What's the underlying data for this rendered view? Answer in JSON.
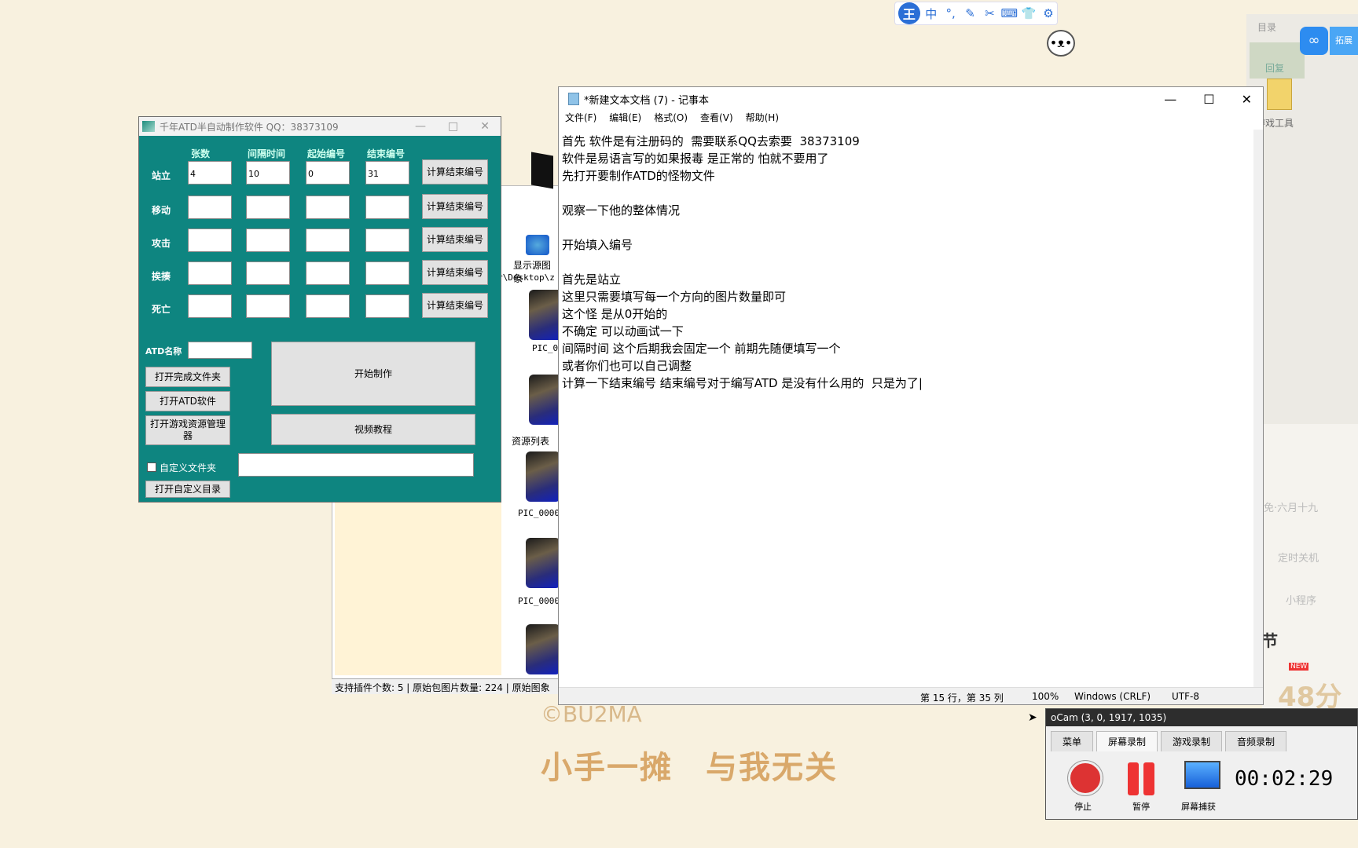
{
  "ime": {
    "logo": "王",
    "items": [
      "中",
      "°,",
      "✎",
      "✂",
      "⌨",
      "👕",
      "⚙"
    ]
  },
  "desktop_right": {
    "mulu": "目录",
    "green_label": "回复",
    "folder_label": "游戏工具",
    "baidu_label": "拓展",
    "items": [
      "免·六月十九",
      "定时关机",
      "小程序",
      "节",
      "48分"
    ],
    "new_badge": "NEW"
  },
  "atd": {
    "title": "千年ATD半自动制作软件 QQ：38373109",
    "headers": [
      "张数",
      "间隔时间",
      "起始编号",
      "结束编号"
    ],
    "rows": [
      {
        "label": "站立",
        "v": [
          "4",
          "10",
          "0",
          "31"
        ]
      },
      {
        "label": "移动",
        "v": [
          "",
          "",
          "",
          ""
        ]
      },
      {
        "label": "攻击",
        "v": [
          "",
          "",
          "",
          ""
        ]
      },
      {
        "label": "挨揍",
        "v": [
          "",
          "",
          "",
          ""
        ]
      },
      {
        "label": "死亡",
        "v": [
          "",
          "",
          "",
          ""
        ]
      }
    ],
    "calc_label": "计算结束编号",
    "atd_name_label": "ATD名称",
    "atd_name_value": "",
    "open_done": "打开完成文件夹",
    "open_atd": "打开ATD软件",
    "open_res": "打开游戏资源管理器",
    "start": "开始制作",
    "video": "视频教程",
    "custom_label": "自定义文件夹",
    "custom_value": "",
    "open_custom": "打开自定义目录"
  },
  "resource": {
    "show_src": "显示源图象",
    "path": "r\\Desktop\\z",
    "list_title": "资源列表",
    "pics": [
      "PIC_00",
      "PIC_0000",
      "PIC_0000"
    ],
    "status": "支持插件个数: 5 | 原始包图片数量: 224 | 原始图象"
  },
  "notepad": {
    "title": "*新建文本文档 (7) - 记事本",
    "menu": [
      "文件(F)",
      "编辑(E)",
      "格式(O)",
      "查看(V)",
      "帮助(H)"
    ],
    "text": "首先 软件是有注册码的  需要联系QQ去索要  38373109\n软件是易语言写的如果报毒 是正常的 怕就不要用了\n先打开要制作ATD的怪物文件\n\n观察一下他的整体情况\n\n开始填入编号\n\n首先是站立\n这里只需要填写每一个方向的图片数量即可\n这个怪 是从0开始的\n不确定 可以动画试一下\n间隔时间 这个后期我会固定一个 前期先随便填写一个\n或者你们也可以自己调整\n计算一下结束编号 结束编号对于编写ATD 是没有什么用的  只是为了|",
    "status": {
      "pos": "第 15 行，第 35 列",
      "zoom": "100%",
      "eol": "Windows (CRLF)",
      "enc": "UTF-8"
    }
  },
  "ocam": {
    "title": "oCam (3, 0, 1917, 1035)",
    "tabs": [
      "菜单",
      "屏幕录制",
      "游戏录制",
      "音频录制"
    ],
    "stop": "停止",
    "pause": "暂停",
    "capture": "屏幕捕获",
    "time": "00:02:29"
  },
  "overlay": {
    "watermark": "©BU2MA",
    "caption": "小手一摊　与我无关"
  }
}
